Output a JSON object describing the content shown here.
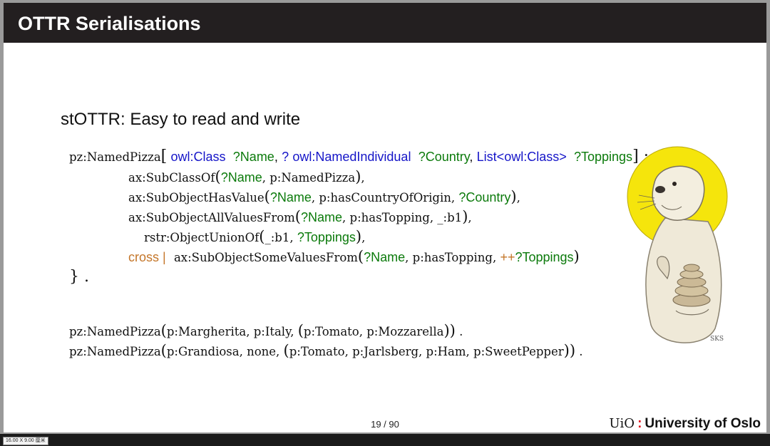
{
  "slide": {
    "title": "OTTR Serialisations",
    "subtitle": "stOTTR: Easy to read and write",
    "page": "19 / 90"
  },
  "code": {
    "template_head": {
      "name": "pz:NamedPizza",
      "p1_type": "owl:Class",
      "p1_var": "?Name",
      "p2_opt": "?",
      "p2_type": "owl:NamedIndividual",
      "p2_var": "?Country",
      "p3_type": "List<owl:Class>",
      "p3_var": "?Toppings",
      "end": "] :: {"
    },
    "line1": {
      "fn": "ax:SubClassOf",
      "var": "?Name",
      "rest": ", p:NamedPizza"
    },
    "line2": {
      "fn": "ax:SubObjectHasValue",
      "var": "?Name",
      "mid": ", p:hasCountryOfOrigin, ",
      "var2": "?Country"
    },
    "line3": {
      "fn": "ax:SubObjectAllValuesFrom",
      "var": "?Name",
      "rest": ", p:hasTopping, _:b1"
    },
    "line4": {
      "fn": "rstr:ObjectUnionOf",
      "first": "_:b1, ",
      "var": "?Toppings"
    },
    "line5": {
      "cross": "cross |",
      "fn": "ax:SubObjectSomeValuesFrom",
      "var": "?Name",
      "mid": ", p:hasTopping, ",
      "expand": "++",
      "var2": "?Toppings"
    },
    "close": "} .",
    "inst1": {
      "fn": "pz:NamedPizza",
      "args": "p:Margherita, p:Italy, ",
      "list": "p:Tomato, p:Mozzarella"
    },
    "inst2": {
      "fn": "pz:NamedPizza",
      "args": "p:Grandiosa, none, ",
      "list": "p:Tomato, p:Jarlsberg, p:Ham, p:SweetPepper"
    }
  },
  "footer": {
    "logo_short": "UiO",
    "logo_colon": ":",
    "logo_text": "University of Oslo"
  },
  "status": {
    "size_label": "16.00 X 9.00 厘米"
  },
  "colors": {
    "title_bar": "#231f20",
    "blue_type": "#1515c8",
    "green_var": "#0b7a0b",
    "orange_keyword": "#c4762a",
    "halo": "#f5e50c"
  },
  "icons": {
    "otter": "otter-with-halo-illustration"
  }
}
